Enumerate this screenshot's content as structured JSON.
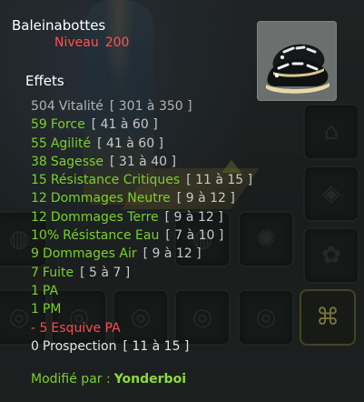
{
  "item": {
    "name": "Baleinabottes",
    "level_label": "Niveau",
    "level": "200",
    "image_icon": "black-white-boots-icon"
  },
  "effects_title": "Effets",
  "effects": [
    {
      "value": "504",
      "name": "Vitalité",
      "range": "[ 301 à 350 ]",
      "color": "#b2b2b2"
    },
    {
      "value": "59",
      "name": "Force",
      "range": "[ 41 à 60 ]",
      "color": "#79d02b"
    },
    {
      "value": "55",
      "name": "Agilité",
      "range": "[ 41 à 60 ]",
      "color": "#79d02b"
    },
    {
      "value": "38",
      "name": "Sagesse",
      "range": "[ 31 à 40 ]",
      "color": "#79d02b"
    },
    {
      "value": "15",
      "name": "Résistance Critiques",
      "range": "[ 11 à 15 ]",
      "color": "#79d02b"
    },
    {
      "value": "12",
      "name": "Dommages Neutre",
      "range": "[ 9 à 12 ]",
      "color": "#79d02b"
    },
    {
      "value": "12",
      "name": "Dommages Terre",
      "range": "[ 9 à 12 ]",
      "color": "#79d02b"
    },
    {
      "value": "10%",
      "name": "Résistance Eau",
      "range": "[ 7 à 10 ]",
      "color": "#79d02b"
    },
    {
      "value": "9",
      "name": "Dommages Air",
      "range": "[ 9 à 12 ]",
      "color": "#79d02b"
    },
    {
      "value": "7",
      "name": "Fuite",
      "range": "[ 5 à 7 ]",
      "color": "#79d02b"
    },
    {
      "value": "1",
      "name": "PA",
      "range": "",
      "color": "#79d02b"
    },
    {
      "value": "1",
      "name": "PM",
      "range": "",
      "color": "#79d02b"
    },
    {
      "value": "- 5",
      "name": "Esquive PA",
      "range": "",
      "color": "#ff4a4a"
    },
    {
      "value": "0",
      "name": "Prospection",
      "range": "[ 11 à 15 ]",
      "color": "#e4e4e4"
    }
  ],
  "modified_by": {
    "label": "Modifié par :",
    "name": "Yonderboi"
  },
  "colors": {
    "stat_positive": "#79d02b",
    "stat_negative": "#ff4a4a",
    "stat_neutral": "#b2b2b2",
    "level": "#ff5252"
  }
}
